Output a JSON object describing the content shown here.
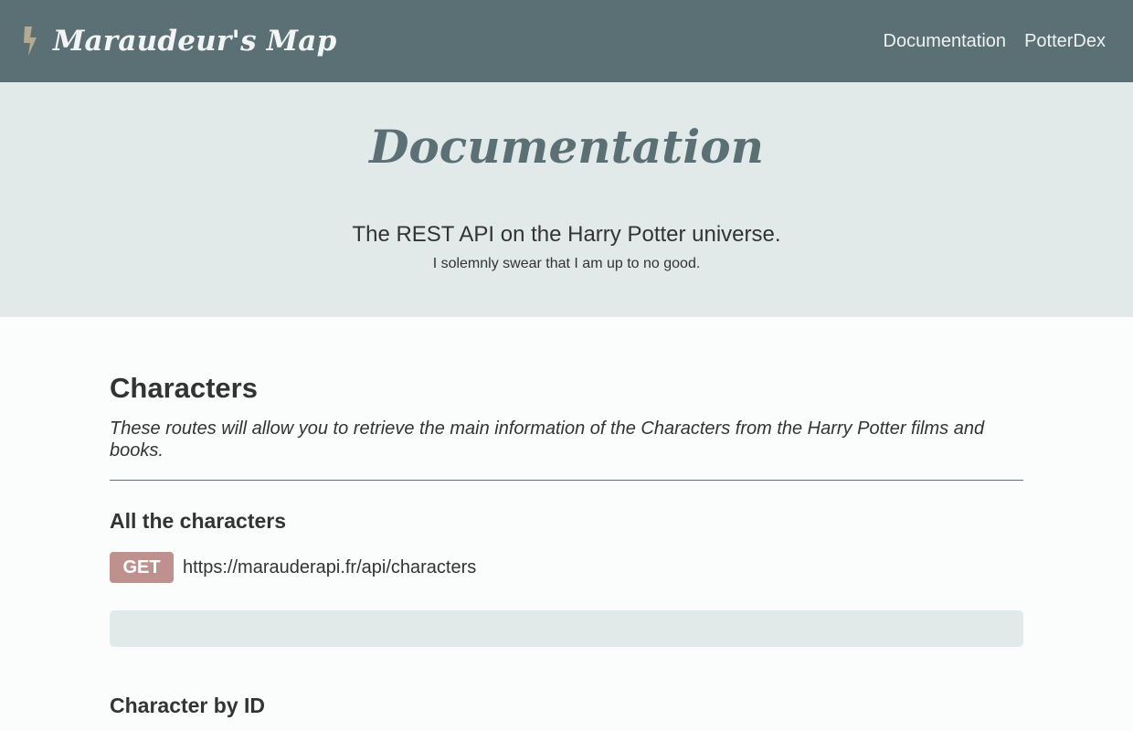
{
  "navbar": {
    "brand": "Maraudeur's Map",
    "brand_icon": "lightning-bolt-icon",
    "links": [
      "Documentation",
      "PotterDex"
    ]
  },
  "hero": {
    "title": "Documentation",
    "subtitle": "The REST API on the Harry Potter universe.",
    "tagline": "I solemnly swear that I am up to no good."
  },
  "section": {
    "title": "Characters",
    "description": "These routes will allow you to retrieve the main information of the Characters from the Harry Potter films and books.",
    "routes": [
      {
        "title": "All the characters",
        "method": "GET",
        "url": "https://marauderapi.fr/api/characters"
      },
      {
        "title": "Character by ID"
      }
    ]
  },
  "colors": {
    "navbar": "#5b7075",
    "hero_bg": "#e2e9e9",
    "method_get": "#bf918e",
    "bolt": "#b7a890"
  }
}
